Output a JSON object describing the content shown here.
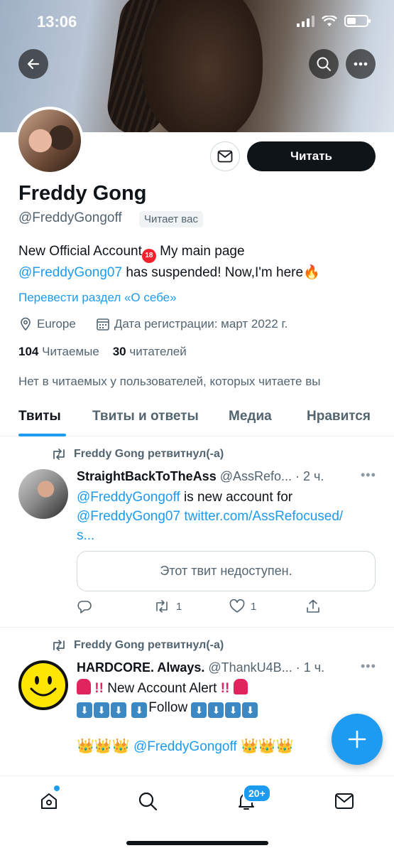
{
  "status_bar": {
    "time": "13:06"
  },
  "profile": {
    "name": "Freddy Gong",
    "handle": "@FreddyGongoff",
    "follows_you": "Читает вас",
    "follow_label": "Читать",
    "bio_line1_text": "New Official Account",
    "bio_badge": "18",
    "bio_line1_tail": " My main page",
    "bio_link": "@FreddyGong07",
    "bio_line2_tail": " has suspended! Now,I'm here",
    "translate_link": "Перевести раздел «О себе»",
    "location": "Europe",
    "joined": "Дата регистрации: март 2022 г.",
    "following_count": "104",
    "following_label": "Читаемые",
    "followers_count": "30",
    "followers_label": "читателей",
    "no_mutuals": "Нет в читаемых у пользователей, которых читаете вы"
  },
  "tabs": [
    {
      "label": "Твиты"
    },
    {
      "label": "Твиты и ответы"
    },
    {
      "label": "Медиа"
    },
    {
      "label": "Нравится"
    }
  ],
  "tweets": [
    {
      "retweet_label": "Freddy Gong ретвитнул(-а)",
      "author_name": "StraightBackToTheAss",
      "author_meta": " @AssRefo... · 2 ч.",
      "text_link1": "@FreddyGongoff",
      "text_mid": " is new account for",
      "text_link2": "@FreddyGong07 twitter.com/AssRefocused/",
      "text_link3": "s...",
      "unavailable": "Этот твит недоступен.",
      "retweets": "1",
      "likes": "1"
    },
    {
      "retweet_label": "Freddy Gong ретвитнул(-а)",
      "author_name": "HARDCORE. Always.",
      "author_meta": " @ThankU4B... · 1 ч.",
      "line1": " New Account Alert ",
      "line2": "Follow",
      "mention": "@FreddyGongoff"
    }
  ],
  "bottom_nav": {
    "notification_badge": "20+"
  },
  "colors": {
    "accent": "#1d9bf0",
    "text": "#0f1419",
    "muted": "#536471"
  }
}
